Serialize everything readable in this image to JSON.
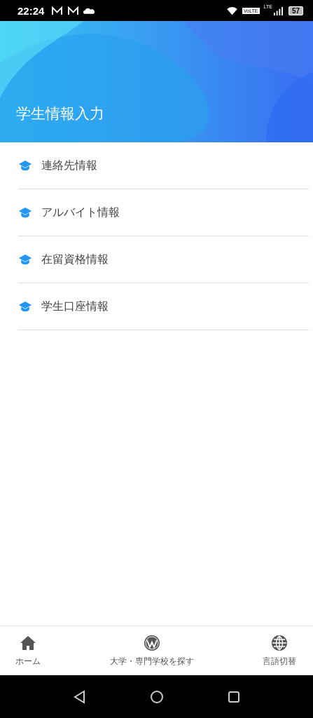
{
  "status_bar": {
    "time": "22:24",
    "volte": "VoLTE",
    "network": "LTE",
    "battery": "57"
  },
  "header": {
    "title": "学生情報入力"
  },
  "menu": [
    {
      "label": "連絡先情報"
    },
    {
      "label": "アルバイト情報"
    },
    {
      "label": "在留資格情報"
    },
    {
      "label": "学生口座情報"
    }
  ],
  "bottom_nav": [
    {
      "kind": "home",
      "label": "ホーム"
    },
    {
      "kind": "wordpress",
      "label": "大学・専門学校を探す"
    },
    {
      "kind": "globe",
      "label": "言語切替"
    }
  ]
}
